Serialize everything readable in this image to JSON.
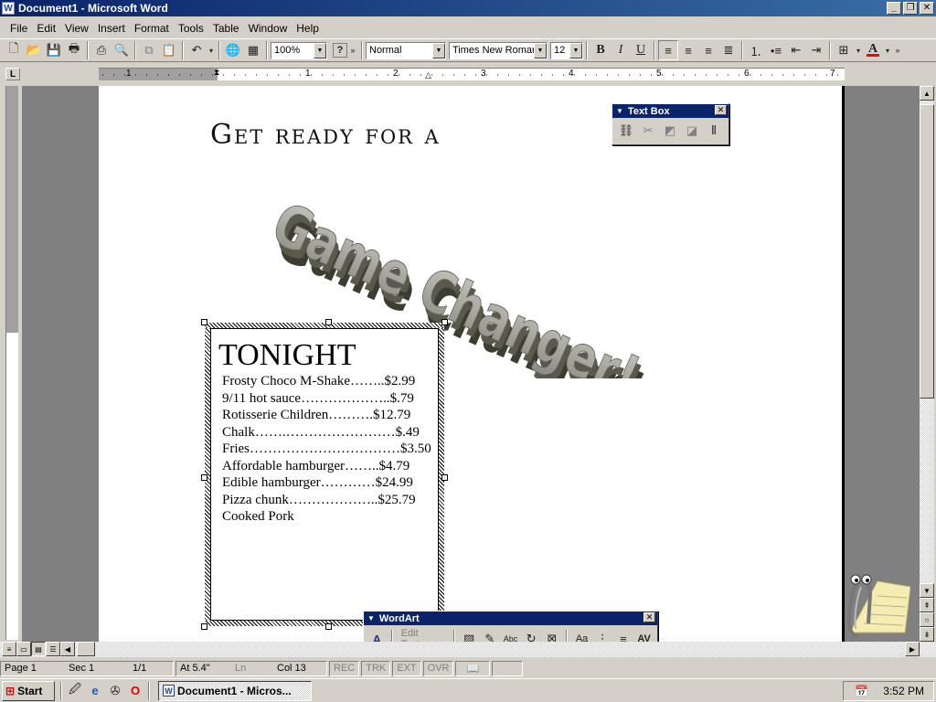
{
  "window": {
    "title": "Document1 - Microsoft Word"
  },
  "menu": [
    "File",
    "Edit",
    "View",
    "Insert",
    "Format",
    "Tools",
    "Table",
    "Window",
    "Help"
  ],
  "toolbar": {
    "zoom": "100%",
    "style": "Normal",
    "font": "Times New Roman",
    "size": "12",
    "help_label": "?"
  },
  "ruler": {
    "numbers": [
      "1",
      "1",
      "2",
      "3",
      "4",
      "5",
      "6",
      "7"
    ],
    "corner": "L"
  },
  "document": {
    "heading": "Get ready for a",
    "wordart": "Game Changer!",
    "textbox": {
      "title": "TONIGHT",
      "items": [
        "Frosty Choco M-Shake……..$2.99",
        "9/11 hot sauce………………..$.79",
        "Rotisserie Children……….$12.79",
        "Chalk…….……………………$.49",
        "Fries……………………………$3.50",
        "Affordable hamburger……..$4.79",
        "Edible hamburger…………$24.99",
        "Pizza chunk………………..$25.79",
        "Cooked Pork"
      ]
    }
  },
  "floating": {
    "textbox_toolbar": {
      "title": "Text Box"
    },
    "wordart_toolbar": {
      "title": "WordArt",
      "edit_text": "Edit Text..."
    }
  },
  "status": {
    "page": "Page  1",
    "sec": "Sec  1",
    "pages": "1/1",
    "at": "At  5.4\"",
    "ln": "Ln",
    "col": "Col  13",
    "rec": "REC",
    "trk": "TRK",
    "ext": "EXT",
    "ovr": "OVR"
  },
  "taskbar": {
    "start": "Start",
    "task": "Document1 - Micros...",
    "clock": "3:52 PM"
  },
  "colors": {
    "titlebar": "#0a246a",
    "face": "#d4d0c8",
    "workspace": "#808080",
    "font_color_bar": "#ff0000"
  }
}
